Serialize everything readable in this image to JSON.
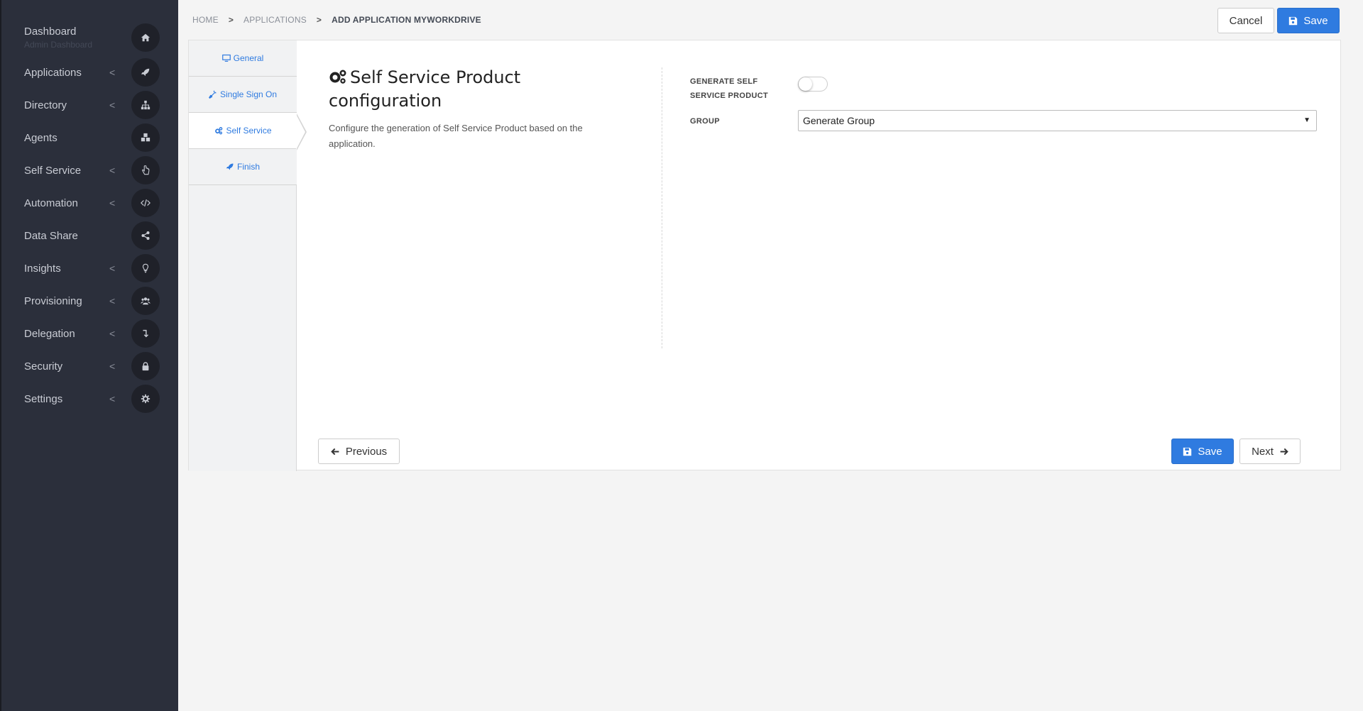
{
  "sidebar": {
    "items": [
      {
        "label": "Dashboard",
        "sub": "Admin Dashboard",
        "icon": "home-icon",
        "chevron": false
      },
      {
        "label": "Applications",
        "icon": "rocket-icon",
        "chevron": true
      },
      {
        "label": "Directory",
        "icon": "sitemap-icon",
        "chevron": true
      },
      {
        "label": "Agents",
        "icon": "cubes-icon",
        "chevron": false
      },
      {
        "label": "Self Service",
        "icon": "hand-pointer-icon",
        "chevron": true
      },
      {
        "label": "Automation",
        "icon": "code-icon",
        "chevron": true
      },
      {
        "label": "Data Share",
        "icon": "share-icon",
        "chevron": false
      },
      {
        "label": "Insights",
        "icon": "lightbulb-icon",
        "chevron": true
      },
      {
        "label": "Provisioning",
        "icon": "users-icon",
        "chevron": true
      },
      {
        "label": "Delegation",
        "icon": "level-down-icon",
        "chevron": true
      },
      {
        "label": "Security",
        "icon": "lock-icon",
        "chevron": true
      },
      {
        "label": "Settings",
        "icon": "gear-icon",
        "chevron": true
      }
    ],
    "chevron_glyph": "<"
  },
  "breadcrumb": {
    "home": "HOME",
    "applications": "APPLICATIONS",
    "current": "ADD APPLICATION MYWORKDRIVE",
    "separator": ">"
  },
  "header": {
    "cancel_label": "Cancel",
    "save_label": "Save"
  },
  "tabs": [
    {
      "label": "General",
      "icon": "desktop-icon"
    },
    {
      "label": "Single Sign On",
      "icon": "plug-icon"
    },
    {
      "label": "Self Service",
      "icon": "gears-icon",
      "active": true
    },
    {
      "label": "Finish",
      "icon": "rocket-icon"
    }
  ],
  "section": {
    "title_line1": "Self Service Product",
    "title_line2": "configuration",
    "description": "Configure the generation of Self Service Product based on the application."
  },
  "form": {
    "generate_label_line1": "GENERATE SELF",
    "generate_label_line2": "SERVICE PRODUCT",
    "generate_enabled": false,
    "group_label": "GROUP",
    "group_value": "Generate Group"
  },
  "footer": {
    "previous_label": "Previous",
    "save_label": "Save",
    "next_label": "Next"
  },
  "colors": {
    "sidebar_bg": "#2b2f3b",
    "primary": "#2f7be0",
    "page_bg": "#f4f4f4"
  }
}
